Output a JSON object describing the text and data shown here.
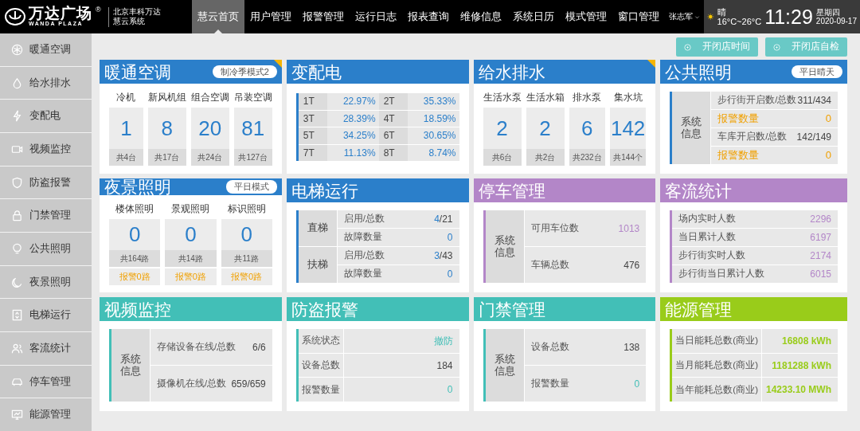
{
  "header": {
    "logo": {
      "name": "万达广场",
      "mark": "®",
      "sub": "WANDA PLAZA"
    },
    "site": [
      "北京丰科万达",
      "慧云系统"
    ],
    "nav": [
      {
        "label": "慧云首页",
        "selected": true
      },
      {
        "label": "用户管理",
        "selected": false
      },
      {
        "label": "报警管理",
        "selected": false
      },
      {
        "label": "运行日志",
        "selected": false
      },
      {
        "label": "报表查询",
        "selected": false
      },
      {
        "label": "维修信息",
        "selected": false
      },
      {
        "label": "系统日历",
        "selected": false
      },
      {
        "label": "模式管理",
        "selected": false
      },
      {
        "label": "窗口管理",
        "selected": false
      }
    ],
    "user": "张志军",
    "weather": {
      "condition": "晴",
      "range": "16°C~26°C"
    },
    "time": "11:29",
    "weekday": "星期四",
    "date": "2020-09-17"
  },
  "sidebar": {
    "items": [
      {
        "label": "暖通空调"
      },
      {
        "label": "给水排水"
      },
      {
        "label": "变配电"
      },
      {
        "label": "视频监控"
      },
      {
        "label": "防盗报警"
      },
      {
        "label": "门禁管理"
      },
      {
        "label": "公共照明"
      },
      {
        "label": "夜景照明"
      },
      {
        "label": "电梯运行"
      },
      {
        "label": "客流统计"
      },
      {
        "label": "停车管理"
      },
      {
        "label": "能源管理"
      }
    ]
  },
  "actions": [
    "开闭店时间",
    "开闭店自检"
  ],
  "cards": [
    {
      "title": "暖通空调",
      "color": "#2b7fca",
      "flagged": true,
      "badge": "制冷季模式2",
      "kind": "tiles",
      "tiles": [
        {
          "label": "冷机",
          "value": "1",
          "total": "共4台"
        },
        {
          "label": "新风机组",
          "value": "8",
          "total": "共17台"
        },
        {
          "label": "组合空调",
          "value": "20",
          "total": "共24台"
        },
        {
          "label": "吊装空调",
          "value": "81",
          "total": "共127台"
        }
      ]
    },
    {
      "title": "变配电",
      "color": "#2b7fca",
      "flagged": false,
      "kind": "pairs",
      "pairs": [
        {
          "label": "1T",
          "value": "22.97%"
        },
        {
          "label": "2T",
          "value": "35.33%"
        },
        {
          "label": "3T",
          "value": "28.39%"
        },
        {
          "label": "4T",
          "value": "18.59%"
        },
        {
          "label": "5T",
          "value": "34.25%"
        },
        {
          "label": "6T",
          "value": "30.65%"
        },
        {
          "label": "7T",
          "value": "11.13%"
        },
        {
          "label": "8T",
          "value": "8.74%"
        }
      ]
    },
    {
      "title": "给水排水",
      "color": "#2b7fca",
      "flagged": true,
      "kind": "tiles",
      "tiles": [
        {
          "label": "生活水泵",
          "value": "2",
          "total": "共6台"
        },
        {
          "label": "生活水箱",
          "value": "2",
          "total": "共2台"
        },
        {
          "label": "排水泵",
          "value": "6",
          "total": "共232台"
        },
        {
          "label": "集水坑",
          "value": "142",
          "total": "共144个"
        }
      ]
    },
    {
      "title": "公共照明",
      "color": "#2b7fca",
      "flagged": false,
      "badge": "平日晴天",
      "kind": "groups",
      "groups": [
        {
          "label": "系统信息",
          "rows": [
            {
              "label": "步行街开启数/总数",
              "value": "311/434",
              "highlight": false,
              "alert": false
            },
            {
              "label": "报警数量",
              "value": "0",
              "highlight": false,
              "alert": true
            },
            {
              "label": "车库开启数/总数",
              "value": "142/149",
              "highlight": false,
              "alert": false
            },
            {
              "label": "报警数量",
              "value": "0",
              "highlight": false,
              "alert": true
            }
          ]
        }
      ]
    },
    {
      "title": "夜景照明",
      "color": "#2b7fca",
      "flagged": false,
      "badge": "平日模式",
      "kind": "tiles",
      "tiles": [
        {
          "label": "楼体照明",
          "value": "0",
          "total": "共164路",
          "alarm": "报警0路"
        },
        {
          "label": "景观照明",
          "value": "0",
          "total": "共14路",
          "alarm": "报警0路"
        },
        {
          "label": "标识照明",
          "value": "0",
          "total": "共11路",
          "alarm": "报警0路"
        }
      ]
    },
    {
      "title": "电梯运行",
      "color": "#2b7fca",
      "flagged": false,
      "kind": "groups",
      "groups": [
        {
          "label": "直梯",
          "rows": [
            {
              "label": "启用/总数",
              "value": "4",
              "suffix": "/21",
              "highlight": true,
              "alert": false
            },
            {
              "label": "故障数量",
              "value": "0",
              "highlight": true,
              "alert": false
            }
          ]
        },
        {
          "label": "扶梯",
          "rows": [
            {
              "label": "启用/总数",
              "value": "3",
              "suffix": "/43",
              "highlight": true,
              "alert": false
            },
            {
              "label": "故障数量",
              "value": "0",
              "highlight": true,
              "alert": false
            }
          ]
        }
      ]
    },
    {
      "title": "停车管理",
      "color": "#b386c8",
      "flagged": false,
      "kind": "groups",
      "groups": [
        {
          "label": "系统信息",
          "rows": [
            {
              "label": "可用车位数",
              "value": "1013",
              "highlight": true,
              "alert": false
            },
            {
              "label": "车辆总数",
              "value": "476",
              "highlight": false,
              "alert": false
            }
          ]
        }
      ]
    },
    {
      "title": "客流统计",
      "color": "#b386c8",
      "flagged": false,
      "kind": "groups",
      "groups": [
        {
          "rows": [
            {
              "label": "场内实时人数",
              "value": "2296",
              "highlight": true,
              "alert": false
            },
            {
              "label": "当日累计人数",
              "value": "6197",
              "highlight": true,
              "alert": false
            },
            {
              "label": "步行街实时人数",
              "value": "2174",
              "highlight": true,
              "alert": false
            },
            {
              "label": "步行街当日累计人数",
              "value": "6015",
              "highlight": true,
              "alert": false
            }
          ]
        }
      ]
    },
    {
      "title": "视频监控",
      "color": "#42bfb7",
      "flagged": false,
      "kind": "groups",
      "groups": [
        {
          "label": "系统信息",
          "rows": [
            {
              "label": "存储设备在线/总数",
              "value": "6/6",
              "highlight": false,
              "alert": false
            },
            {
              "label": "摄像机在线/总数",
              "value": "659/659",
              "highlight": false,
              "alert": false
            }
          ]
        }
      ]
    },
    {
      "title": "防盗报警",
      "color": "#42bfb7",
      "flagged": false,
      "kind": "groups",
      "split": true,
      "groups": [
        {
          "rows": [
            {
              "label": "系统状态",
              "value": "撤防",
              "highlight": true,
              "alert": false
            },
            {
              "label": "设备总数",
              "value": "184",
              "highlight": false,
              "alert": false
            },
            {
              "label": "报警数量",
              "value": "0",
              "highlight": true,
              "alert": false
            }
          ]
        }
      ]
    },
    {
      "title": "门禁管理",
      "color": "#42bfb7",
      "flagged": false,
      "kind": "groups",
      "groups": [
        {
          "label": "系统信息",
          "rows": [
            {
              "label": "设备总数",
              "value": "138",
              "highlight": false,
              "alert": false
            },
            {
              "label": "报警数量",
              "value": "0",
              "highlight": true,
              "alert": false
            }
          ]
        }
      ]
    },
    {
      "title": "能源管理",
      "color": "#99cc1a",
      "flagged": false,
      "kind": "groups",
      "split": true,
      "groups": [
        {
          "rows": [
            {
              "label": "当日能耗总数(商业)",
              "value": "16808 kWh",
              "highlight": true,
              "alert": false
            },
            {
              "label": "当月能耗总数(商业)",
              "value": "1181288 kWh",
              "highlight": true,
              "alert": false
            },
            {
              "label": "当年能耗总数(商业)",
              "value": "14233.10 MWh",
              "highlight": true,
              "alert": false
            }
          ]
        }
      ]
    }
  ]
}
